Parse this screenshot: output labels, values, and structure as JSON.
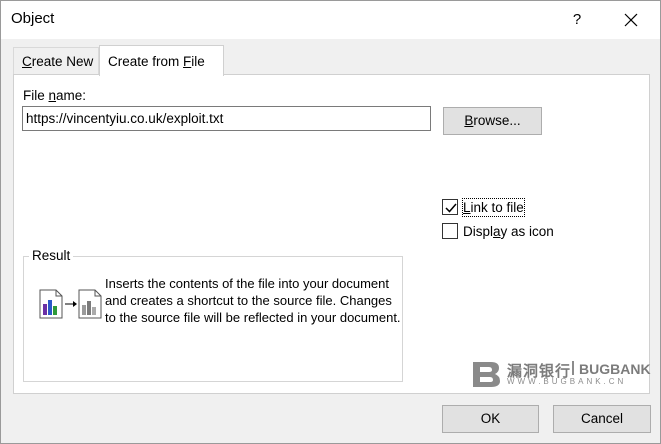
{
  "window": {
    "title": "Object"
  },
  "titlebar": {
    "help_label": "?"
  },
  "tabs": [
    {
      "label_pre": "",
      "label_key": "C",
      "label_post": "reate New"
    },
    {
      "label_pre": "Create from ",
      "label_key": "F",
      "label_post": "ile"
    }
  ],
  "active_tab": "Create from File",
  "file": {
    "label_pre": "File ",
    "label_key": "n",
    "label_post": "ame:",
    "value": "https://vincentyiu.co.uk/exploit.txt"
  },
  "browse": {
    "label_key": "B",
    "label_post": "rowse..."
  },
  "options": {
    "link": {
      "label_pre": "",
      "label_key": "L",
      "label_post": "ink to file",
      "checked": true
    },
    "display_icon": {
      "label_pre": "Displ",
      "label_key": "a",
      "label_post": "y as icon",
      "checked": false
    }
  },
  "result": {
    "legend": "Result",
    "text": "Inserts the contents of the file into your document and creates a shortcut to the source file.  Changes to the source file will be reflected in your document."
  },
  "buttons": {
    "ok": "OK",
    "cancel": "Cancel"
  },
  "watermark": {
    "cn": "漏洞银行",
    "en": "BUGBANK",
    "url": "WWW.BUGBANK.CN"
  },
  "colors": {
    "chart_purple": "#6a2fa5",
    "chart_blue": "#2b58c8",
    "chart_green": "#2e9a3a"
  }
}
